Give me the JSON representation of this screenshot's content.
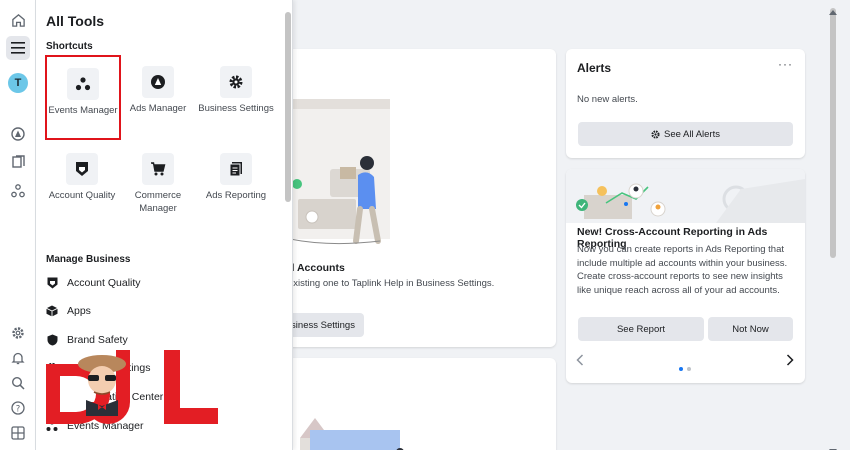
{
  "panel": {
    "title": "All Tools",
    "shortcuts_title": "Shortcuts",
    "shortcuts": [
      {
        "label": "Events Manager",
        "icon": "events-manager-icon"
      },
      {
        "label": "Ads Manager",
        "icon": "ads-manager-icon"
      },
      {
        "label": "Business Settings",
        "icon": "gear-icon"
      },
      {
        "label": "Account Quality",
        "icon": "shield-icon"
      },
      {
        "label": "Commerce Manager",
        "icon": "cart-icon"
      },
      {
        "label": "Ads Reporting",
        "icon": "report-icon"
      }
    ],
    "manage_title": "Manage Business",
    "manage_items": [
      {
        "label": "Account Quality",
        "icon": "shield-icon"
      },
      {
        "label": "Apps",
        "icon": "cube-icon"
      },
      {
        "label": "Brand Safety",
        "icon": "shield-check-icon"
      },
      {
        "label": "Business Settings",
        "icon": "gear-icon"
      },
      {
        "label": "Collaboration Center",
        "icon": "handshake-icon"
      },
      {
        "label": "Events Manager",
        "icon": "events-manager-icon"
      }
    ]
  },
  "rail": {
    "avatar_initial": "T",
    "icons": [
      "home-icon",
      "menu-icon",
      "ads-manager-icon",
      "pages-icon",
      "events-manager-icon",
      "gear-icon",
      "bell-icon",
      "search-icon",
      "help-icon",
      "grid-icon"
    ]
  },
  "alerts": {
    "title": "Alerts",
    "more": "···",
    "empty": "No new alerts.",
    "button": "See All Alerts"
  },
  "cross_report": {
    "title": "New! Cross-Account Reporting in Ads Reporting",
    "body": "Now you can create reports in Ads Reporting that include multiple ad accounts within your business. Create cross-account reports to see new insights like unique reach across all of your ad accounts.",
    "see_report": "See Report",
    "not_now": "Not Now"
  },
  "main_card": {
    "heading": "d Accounts",
    "text": "existing one to Taplink Help in Business Settings.",
    "button": "siness Settings"
  },
  "colors": {
    "highlight": "#e0141b",
    "accent": "#1877f2",
    "watermark_red": "#e31e24"
  }
}
